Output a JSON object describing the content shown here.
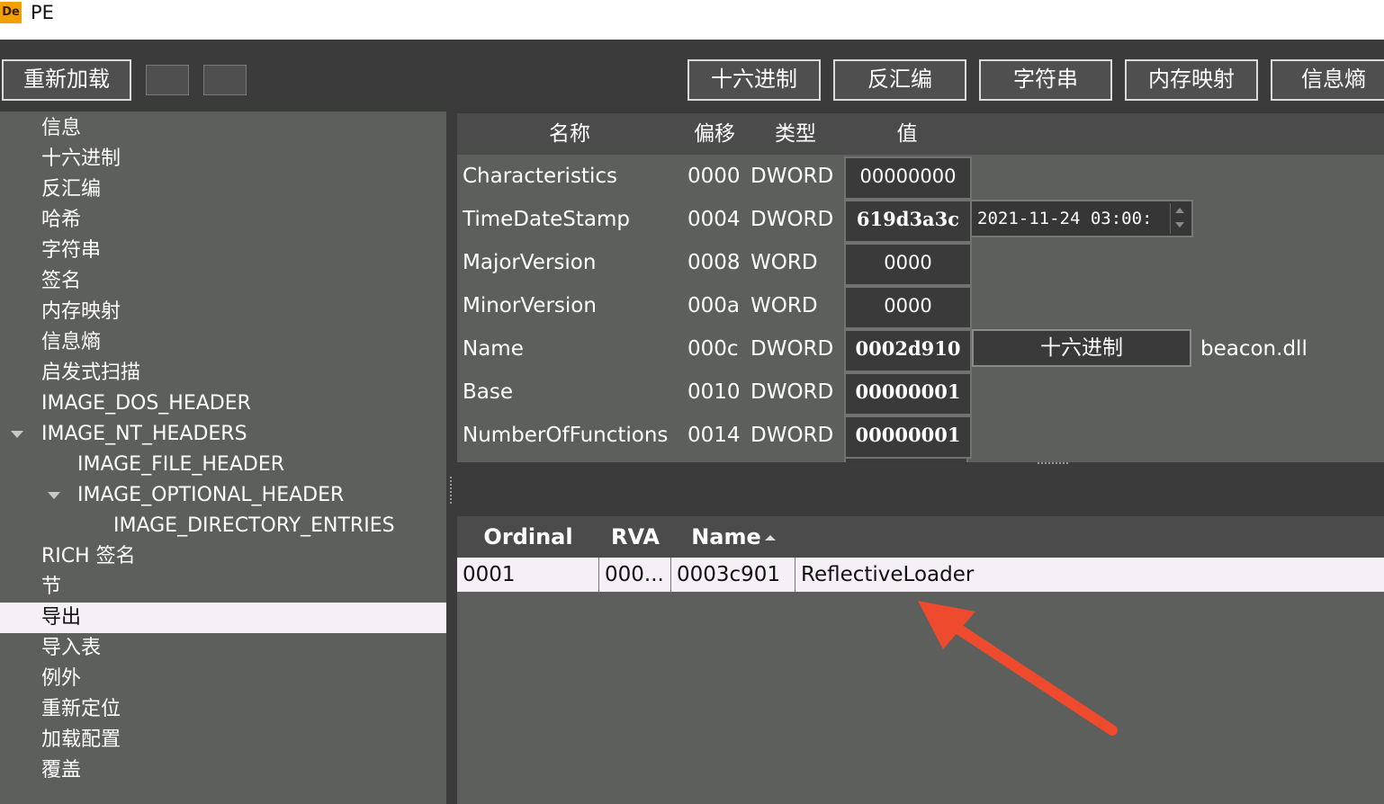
{
  "window": {
    "title": "PE",
    "app_icon_text": "De"
  },
  "toolbar": {
    "reload_label": "重新加载",
    "tabs": [
      "十六进制",
      "反汇编",
      "字符串",
      "内存映射",
      "信息熵"
    ]
  },
  "tree": {
    "items": [
      "信息",
      "十六进制",
      "反汇编",
      "哈希",
      "字符串",
      "签名",
      "内存映射",
      "信息熵",
      "启发式扫描",
      "IMAGE_DOS_HEADER",
      "IMAGE_NT_HEADERS",
      "IMAGE_FILE_HEADER",
      "IMAGE_OPTIONAL_HEADER",
      "IMAGE_DIRECTORY_ENTRIES",
      "RICH 签名",
      "节",
      "导出",
      "导入表",
      "例外",
      "重新定位",
      "加载配置",
      "覆盖"
    ],
    "selected": "导出"
  },
  "upper_table": {
    "headers": [
      "名称",
      "偏移",
      "类型",
      "值"
    ],
    "rows": [
      {
        "name": "Characteristics",
        "offset": "0000",
        "type": "DWORD",
        "value": "00000000"
      },
      {
        "name": "TimeDateStamp",
        "offset": "0004",
        "type": "DWORD",
        "value": "619d3a3c",
        "extra": "2021-11-24 03:00:"
      },
      {
        "name": "MajorVersion",
        "offset": "0008",
        "type": "WORD",
        "value": "0000"
      },
      {
        "name": "MinorVersion",
        "offset": "000a",
        "type": "WORD",
        "value": "0000"
      },
      {
        "name": "Name",
        "offset": "000c",
        "type": "DWORD",
        "value": "0002d910",
        "button": "十六进制",
        "extra": "beacon.dll"
      },
      {
        "name": "Base",
        "offset": "0010",
        "type": "DWORD",
        "value": "00000001"
      },
      {
        "name": "NumberOfFunctions",
        "offset": "0014",
        "type": "DWORD",
        "value": "00000001"
      }
    ]
  },
  "lower_table": {
    "headers": [
      "Ordinal",
      "RVA",
      "Name"
    ],
    "rows": [
      {
        "ordinal": "0001",
        "rva": "000...",
        "name_rva": "0003c901",
        "name": "ReflectiveLoader"
      }
    ]
  },
  "colors": {
    "annotation_arrow": "#ee4a2e",
    "selection": "#f5f0f5",
    "panel": "#5d5f5c",
    "toolbar": "#3b3b3b"
  }
}
